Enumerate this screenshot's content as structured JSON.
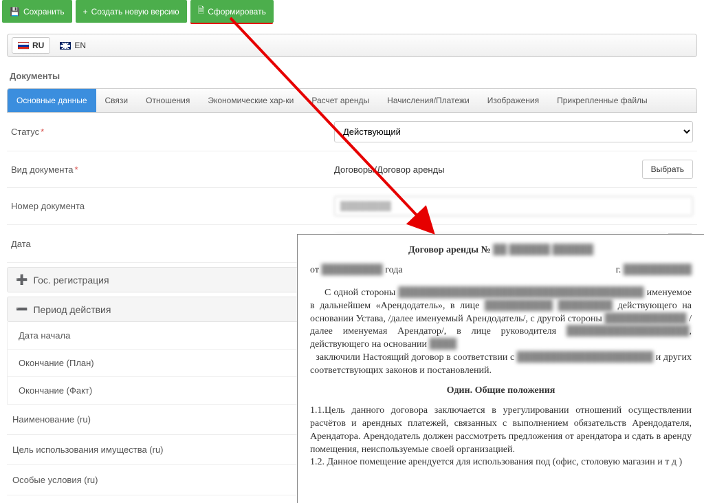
{
  "toolbar": {
    "save": "Сохранить",
    "new_version": "Создать новую версию",
    "generate": "Сформировать"
  },
  "lang": {
    "ru": "RU",
    "en": "EN"
  },
  "section_title": "Документы",
  "tabs": {
    "main": "Основные данные",
    "links": "Связи",
    "relations": "Отношения",
    "econ": "Экономические хар-ки",
    "calc": "Расчет аренды",
    "charges": "Начисления/Платежи",
    "images": "Изображения",
    "files": "Прикрепленные файлы"
  },
  "form": {
    "status_label": "Статус",
    "status_value": "Действующий",
    "doctype_label": "Вид документа",
    "doctype_value": "Договоры/Договор аренды",
    "select_btn": "Выбрать",
    "docnum_label": "Номер документа",
    "docnum_value": "████████",
    "date_label": "Дата",
    "date_value": "████████"
  },
  "accordion": {
    "gosreg": "Гос. регистрация",
    "period": "Период действия",
    "start": "Дата начала",
    "end_plan": "Окончание (План)",
    "end_fact": "Окончание (Факт)"
  },
  "plain": {
    "name_ru": "Наименование (ru)",
    "purpose_ru": "Цель использования имущества (ru)",
    "special_ru": "Особые условия (ru)"
  },
  "doc": {
    "title_prefix": "Договор аренды № ",
    "title_num": "██ ██████ ██████",
    "date_prefix": "от ",
    "date_val": "█████████",
    "date_suffix": " года",
    "city_prefix": "г. ",
    "city_val": "██████████",
    "p1_a": "С одной стороны ",
    "p1_blur1": "████████████████████████████████████",
    "p1_b": " именуемое в дальнейшем «Арендодатель», в лице ",
    "p1_blur2": "██████████ ████████",
    "p1_c": " действующего на основании Устава, /далее именуемый Арендодатель/, с другой стороны ",
    "p1_blur3": "████████████",
    "p1_d": " /далее именуемая Арендатор/, в лице руководителя ",
    "p1_blur4": "██████████████████",
    "p1_e": ", действующего на основании ",
    "p1_blur5": "████",
    "p2_a": "заключили Настоящий договор в соответствии с ",
    "p2_blur": "████████████████████",
    "p2_b": " и других соответствующих законов и постановлений.",
    "h1": "Один. Общие положения",
    "p11": "1.1.Цель данного договора заключается в урегулировании отношений осуществлении расчётов и арендных платежей, связанных с   выполнением обязательств Арендодателя, Арендатора. Арендодатель должен рассмотреть предложения от арендатора и сдать в аренду помещения, неиспользуемые своей организацией.",
    "p12": "1.2. Данное помещение арендуется для использования под (офис, столовую магазин и т д )"
  }
}
